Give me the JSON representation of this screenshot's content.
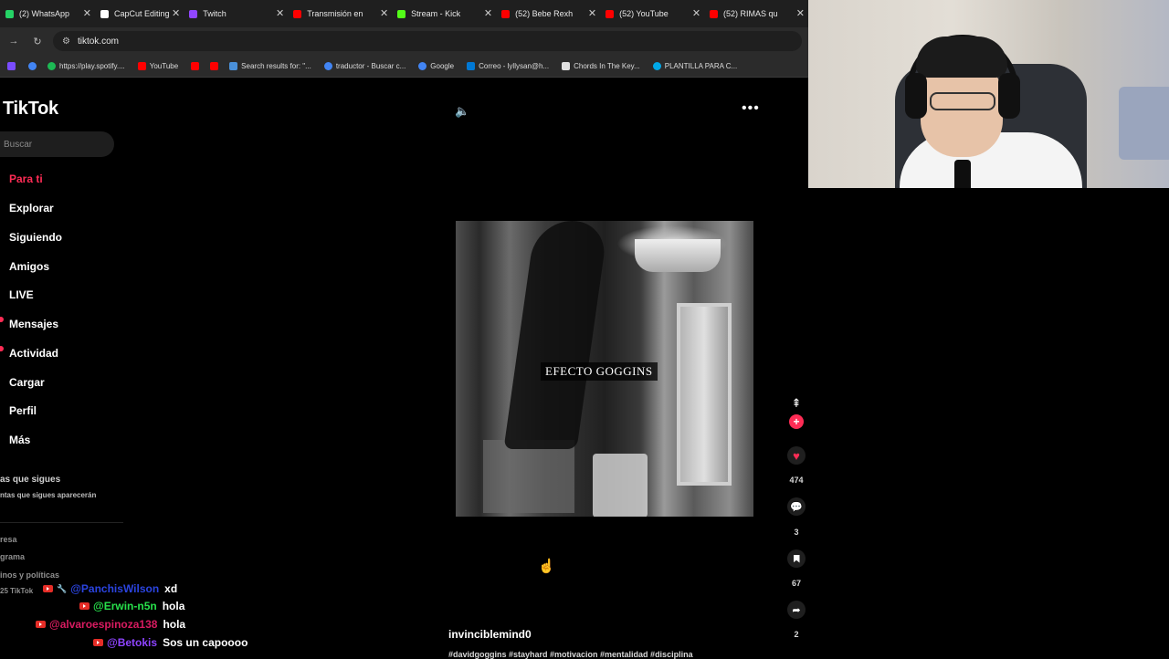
{
  "browser": {
    "tabs": [
      {
        "label": "(2) WhatsApp",
        "badge": "2",
        "color": "#25d366"
      },
      {
        "label": "CapCut Editing",
        "color": "#ffffff"
      },
      {
        "label": "Twitch",
        "color": "#9146ff"
      },
      {
        "label": "Transmisión en",
        "color": "#ff0000"
      },
      {
        "label": "Stream - Kick",
        "color": "#53fc18"
      },
      {
        "label": "(52) Bebe Rexh",
        "color": "#ff0000"
      },
      {
        "label": "(52) YouTube",
        "color": "#ff0000"
      },
      {
        "label": "(52) RIMAS qu",
        "color": "#ff0000"
      }
    ],
    "url": "tiktok.com",
    "bookmarks": [
      {
        "label": "",
        "color": "#7a4cff"
      },
      {
        "label": "",
        "color": "#4285f4"
      },
      {
        "label": "https://play.spotify....",
        "color": "#1db954"
      },
      {
        "label": "YouTube",
        "color": "#ff0000"
      },
      {
        "label": "",
        "color": "#ff0000"
      },
      {
        "label": "",
        "color": "#ff0000"
      },
      {
        "label": "Search results for: \"...",
        "color": "#4a90d9"
      },
      {
        "label": "traductor - Buscar c...",
        "color": "#4285f4"
      },
      {
        "label": "Google",
        "color": "#4285f4"
      },
      {
        "label": "Correo - lyllysan@h...",
        "color": "#0078d4"
      },
      {
        "label": "Chords In The Key...",
        "color": "#e0e0e0"
      },
      {
        "label": "PLANTILLA PARA C...",
        "color": "#00a8e8"
      }
    ]
  },
  "tiktok": {
    "logo": "TikTok",
    "search_placeholder": "Buscar",
    "nav": [
      "Para ti",
      "Explorar",
      "Siguiendo",
      "Amigos",
      "LIVE",
      "Mensajes",
      "Actividad",
      "Cargar",
      "Perfil",
      "Más"
    ],
    "following_title": "as que sigues",
    "following_sub": "ntas que sigues aparecerán",
    "footer": [
      "resa",
      "grama",
      "inos y políticas"
    ],
    "copyright": "25 TikTok"
  },
  "video": {
    "caption": "EFECTO GOGGINS",
    "author": "invinciblemind0",
    "hashtags": "#davidgoggins #stayhard #motivacion #mentalidad #disciplina",
    "counts": {
      "likes": "474",
      "comments": "3",
      "saves": "67",
      "shares": "2"
    }
  },
  "chat": [
    {
      "user": "@PanchisWilson",
      "msg": "xd",
      "color": "#2b44e0"
    },
    {
      "user": "@Erwin-n5n",
      "msg": "hola",
      "color": "#27e04b"
    },
    {
      "user": "@alvaroespinoza138",
      "msg": "hola",
      "color": "#d81b60"
    },
    {
      "user": "@Betokis",
      "msg": "Sos un capoooo",
      "color": "#8e44ff"
    }
  ],
  "colors": {
    "accent": "#fe2c55",
    "background": "#000000"
  }
}
